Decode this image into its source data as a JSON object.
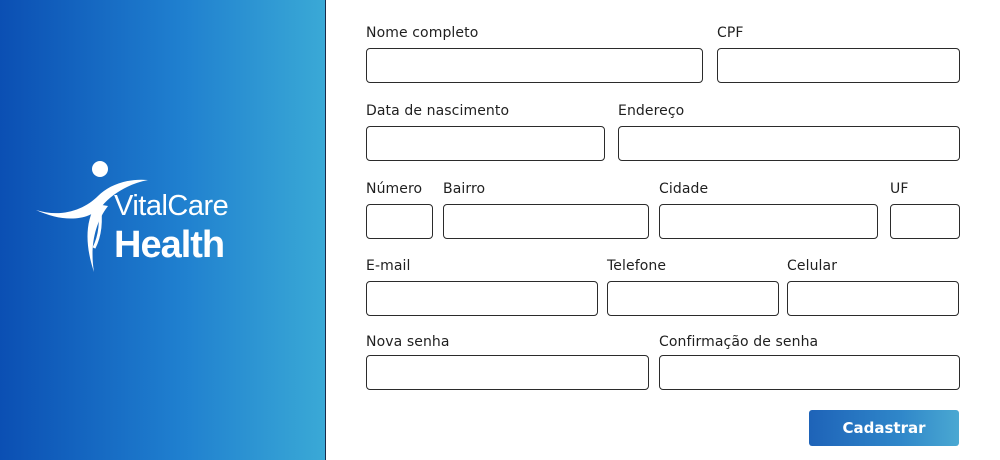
{
  "brand": {
    "name_top": "VitalCare",
    "name_bottom": "Health",
    "logo_icon": "person-figure-icon",
    "colors": {
      "gradient_start": "#0b4fb3",
      "gradient_end": "#3aa9d6"
    }
  },
  "form": {
    "fields": {
      "nome_completo": {
        "label": "Nome completo",
        "value": ""
      },
      "cpf": {
        "label": "CPF",
        "value": ""
      },
      "data_nascimento": {
        "label": "Data de nascimento",
        "value": ""
      },
      "endereco": {
        "label": "Endereço",
        "value": ""
      },
      "numero": {
        "label": "Número",
        "value": ""
      },
      "bairro": {
        "label": "Bairro",
        "value": ""
      },
      "cidade": {
        "label": "Cidade",
        "value": ""
      },
      "uf": {
        "label": "UF",
        "value": ""
      },
      "email": {
        "label": "E-mail",
        "value": ""
      },
      "telefone": {
        "label": "Telefone",
        "value": ""
      },
      "celular": {
        "label": "Celular",
        "value": ""
      },
      "nova_senha": {
        "label": "Nova senha",
        "value": ""
      },
      "confirmacao_senha": {
        "label": "Confirmação de senha",
        "value": ""
      }
    },
    "submit_label": "Cadastrar",
    "colors": {
      "button_start": "#1e63b8",
      "button_end": "#4aa8d2"
    }
  }
}
